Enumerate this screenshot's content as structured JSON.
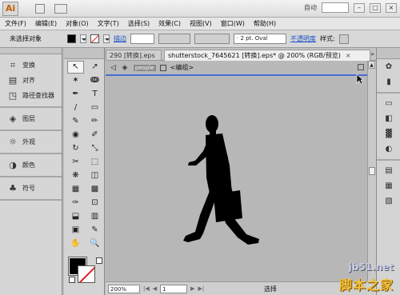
{
  "app": {
    "logo_text": "Ai",
    "workspace_label": "自动"
  },
  "menu": [
    "文件(F)",
    "编辑(E)",
    "对象(O)",
    "文字(T)",
    "选择(S)",
    "效果(C)",
    "视图(V)",
    "窗口(W)",
    "帮助(H)"
  ],
  "control_bar": {
    "selection_label": "未选择对象",
    "stroke_link": "描边",
    "stroke_profile": "· 2 pt. Oval",
    "opacity_link": "不透明度",
    "style_label": "样式:",
    "fill_color": "#000000",
    "stroke_color": "none"
  },
  "left_panel": {
    "group1": [
      {
        "icon": "transform-icon",
        "label": "变换"
      },
      {
        "icon": "align-icon",
        "label": "对齐"
      },
      {
        "icon": "pathfinder-icon",
        "label": "路径查找器"
      }
    ],
    "group2": [
      {
        "icon": "layers-icon",
        "label": "图层"
      }
    ],
    "group3": [
      {
        "icon": "appearance-icon",
        "label": "外观"
      }
    ],
    "group4": [
      {
        "icon": "color-icon",
        "label": "颜色"
      }
    ],
    "group5": [
      {
        "icon": "symbols-icon",
        "label": "符号"
      }
    ]
  },
  "tools": [
    "↖",
    "↗",
    "✶",
    "ↈ",
    "✒",
    "T",
    "/",
    "▭",
    "✎",
    "✏",
    "◉",
    "✐",
    "↻",
    "⤡",
    "✂",
    "⬚",
    "❋",
    "◫",
    "▦",
    "▩",
    "✑",
    "⊡",
    "⬓",
    "▥",
    "▣",
    "✎",
    "✋",
    "🔍"
  ],
  "tabs": {
    "inactive": "290 [转换].eps",
    "active": "shutterstock_7645621 [转换].eps* @ 200% (RGB/预览)",
    "close": "×",
    "more": "»"
  },
  "isolation": {
    "back": "◁",
    "layer": "people",
    "group": "<编组>"
  },
  "status_bar": {
    "zoom": "200%",
    "page": "1",
    "status": "选择"
  },
  "right_panel": [
    "✿",
    "▮",
    "▭",
    "◧",
    "▓",
    "◐",
    "▤",
    "▦",
    "▧"
  ],
  "watermark": {
    "url": "jb51.net",
    "text": "脚本之家"
  }
}
